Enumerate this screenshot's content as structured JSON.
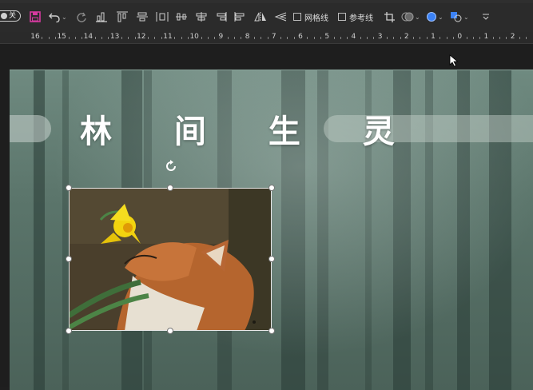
{
  "toolbar": {
    "toggle_label": "关",
    "gridlines_label": "网格线",
    "guides_label": "参考线",
    "icons": [
      "save-icon",
      "undo-icon",
      "redo-icon",
      "chart-bar-icon",
      "align-top-icon",
      "align-middle-icon",
      "distribute-horizontal-icon",
      "distribute-vertical-icon",
      "align-center-icon",
      "align-right-icon",
      "align-left-icon",
      "flip-horizontal-icon",
      "flip-vertical-icon",
      "crop-icon",
      "shape-merge-icon",
      "shape-fill-icon",
      "shape-outline-icon",
      "more-icon"
    ]
  },
  "ruler": {
    "labels": [
      "16",
      "15",
      "14",
      "13",
      "12",
      "11",
      "10",
      "9",
      "8",
      "7",
      "6",
      "5",
      "4",
      "3",
      "2",
      "1",
      "0",
      "1",
      "2"
    ]
  },
  "slide": {
    "title": "林 间 生 灵"
  },
  "colors": {
    "accent_pink": "#d63aa0",
    "selection_blue": "#3b82f6"
  }
}
